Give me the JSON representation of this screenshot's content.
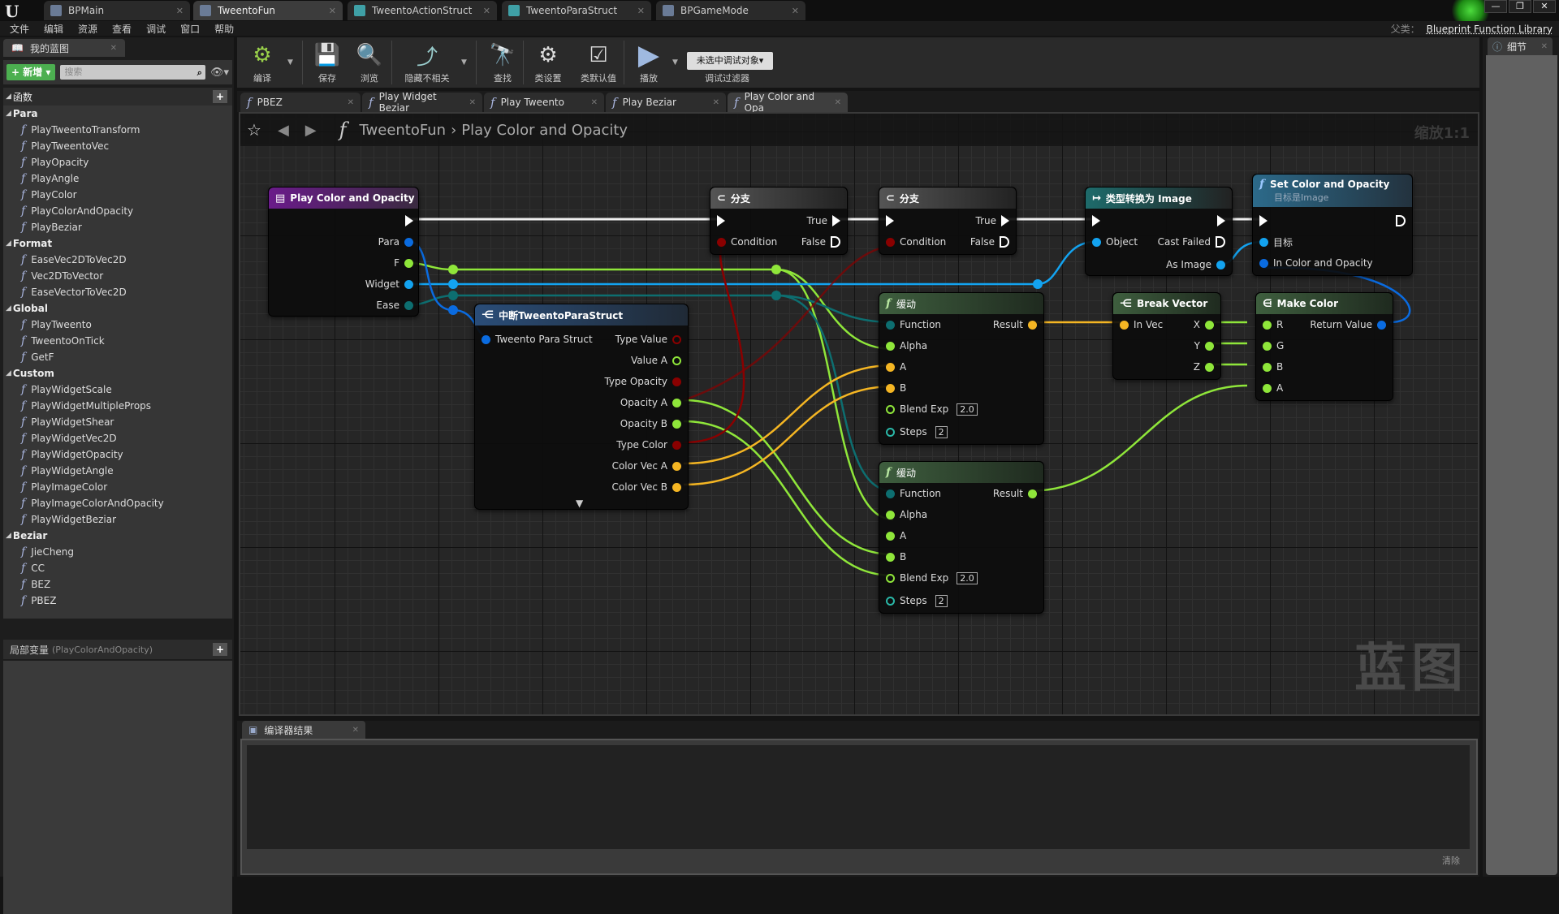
{
  "window": {
    "tabs": [
      {
        "label": "BPMain",
        "active": false
      },
      {
        "label": "TweentoFun",
        "active": true
      },
      {
        "label": "TweentoActionStruct",
        "active": false
      },
      {
        "label": "TweentoParaStruct",
        "active": false
      },
      {
        "label": "BPGameMode",
        "active": false
      }
    ],
    "controls": {
      "minimize": "—",
      "restore": "❐",
      "close": "✕"
    },
    "parent_class_label": "父类：",
    "parent_class_value": "Blueprint Function Library"
  },
  "menu": [
    "文件",
    "编辑",
    "资源",
    "查看",
    "调试",
    "窗口",
    "帮助"
  ],
  "my_blueprint": {
    "tab_label": "我的蓝图",
    "new_button": "+ 新增 ▾",
    "search_placeholder": "搜索",
    "functions_header": "函数",
    "categories": [
      {
        "name": "Para",
        "items": [
          "PlayTweentoTransform",
          "PlayTweentoVec",
          "PlayOpacity",
          "PlayAngle",
          "PlayColor",
          "PlayColorAndOpacity",
          "PlayBeziar"
        ]
      },
      {
        "name": "Format",
        "items": [
          "EaseVec2DToVec2D",
          "Vec2DToVector",
          "EaseVectorToVec2D"
        ]
      },
      {
        "name": "Global",
        "items": [
          "PlayTweento",
          "TweentoOnTick",
          "GetF"
        ]
      },
      {
        "name": "Custom",
        "items": [
          "PlayWidgetScale",
          "PlayWidgetMultipleProps",
          "PlayWidgetShear",
          "PlayWidgetVec2D",
          "PlayWidgetOpacity",
          "PlayWidgetAngle",
          "PlayImageColor",
          "PlayImageColorAndOpacity",
          "PlayWidgetBeziar"
        ]
      },
      {
        "name": "Beziar",
        "items": [
          "JieCheng",
          "CC",
          "BEZ",
          "PBEZ"
        ]
      }
    ],
    "locals_label": "局部变量",
    "locals_context": "(PlayColorAndOpacity)"
  },
  "toolbar": {
    "compile": "编译",
    "save": "保存",
    "browse": "浏览",
    "hide_unrelated": "隐藏不相关",
    "find": "查找",
    "class_settings": "类设置",
    "class_defaults": "类默认值",
    "play": "播放",
    "debug_object": "未选中调试对象▾",
    "debug_filter": "调试过滤器"
  },
  "graph_tabs": [
    {
      "label": "PBEZ",
      "active": false
    },
    {
      "label": "Play Widget Beziar",
      "active": false
    },
    {
      "label": "Play Tweento",
      "active": false
    },
    {
      "label": "Play Beziar",
      "active": false
    },
    {
      "label": "Play Color and Opa",
      "active": true
    }
  ],
  "graph": {
    "breadcrumb_root": "TweentoFun",
    "breadcrumb_sep": "›",
    "breadcrumb_current": "Play Color and Opacity",
    "zoom": "缩放1:1",
    "watermark": "蓝图",
    "nodes": {
      "entry": {
        "title": "Play Color and Opacity",
        "pins": [
          "Para",
          "F",
          "Widget",
          "Ease"
        ]
      },
      "branch1": {
        "title": "分支",
        "true": "True",
        "false": "False",
        "condition": "Condition"
      },
      "branch2": {
        "title": "分支",
        "true": "True",
        "false": "False",
        "condition": "Condition"
      },
      "cast": {
        "title": "类型转换为 Image",
        "object": "Object",
        "cast_failed": "Cast Failed",
        "as_image": "As Image"
      },
      "set_color": {
        "title": "Set Color and Opacity",
        "subtitle": "目标是Image",
        "target": "目标",
        "in_color": "In Color and Opacity"
      },
      "break_struct": {
        "title": "中断TweentoParaStruct",
        "input": "Tweento Para Struct",
        "outputs": [
          "Type Value",
          "Value A",
          "Type Opacity",
          "Opacity A",
          "Opacity B",
          "Type Color",
          "Color Vec A",
          "Color Vec B"
        ]
      },
      "ease1": {
        "title": "缓动",
        "function": "Function",
        "alpha": "Alpha",
        "a": "A",
        "b": "B",
        "blend_exp": "Blend Exp",
        "blend_exp_value": "2.0",
        "steps": "Steps",
        "steps_value": "2",
        "result": "Result"
      },
      "ease2": {
        "title": "缓动",
        "function": "Function",
        "alpha": "Alpha",
        "a": "A",
        "b": "B",
        "blend_exp": "Blend Exp",
        "blend_exp_value": "2.0",
        "steps": "Steps",
        "steps_value": "2",
        "result": "Result"
      },
      "break_vector": {
        "title": "Break Vector",
        "in": "In Vec",
        "x": "X",
        "y": "Y",
        "z": "Z"
      },
      "make_color": {
        "title": "Make Color",
        "r": "R",
        "g": "G",
        "b": "B",
        "a": "A",
        "ret": "Return Value"
      }
    }
  },
  "compiler": {
    "tab_label": "编译器结果",
    "clear": "清除"
  },
  "details": {
    "tab_label": "细节"
  },
  "colors": {
    "exec": "#ffffff",
    "struct": "#0a6be0",
    "float": "#8fe63a",
    "object": "#13a3f0",
    "enum": "#0a6b6b",
    "bool": "#8a0000",
    "vector": "#f5b623",
    "byte": "#0a6b6b"
  }
}
